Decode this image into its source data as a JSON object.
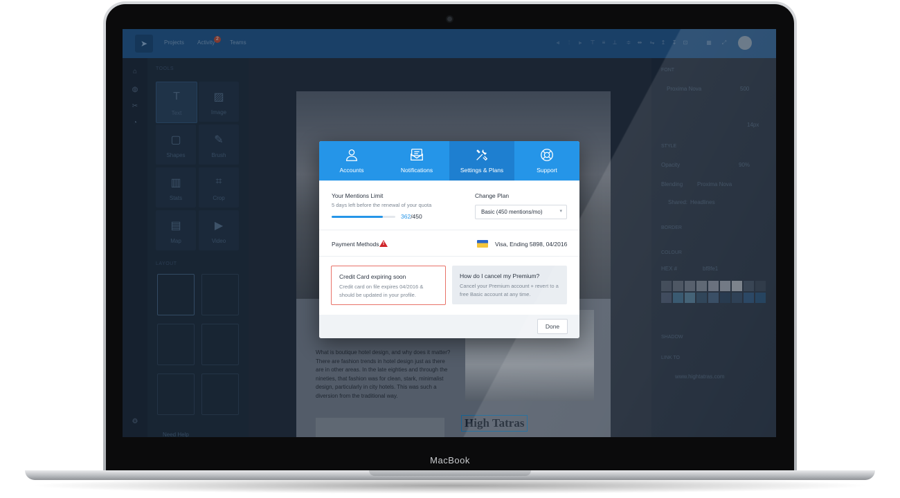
{
  "device": {
    "label": "MacBook"
  },
  "app": {
    "nav": {
      "projects": "Projects",
      "activity": "Activity",
      "activity_badge": "2",
      "teams": "Teams"
    },
    "tools_section": "TOOLS",
    "tools": [
      {
        "label": "Text",
        "icon": "text-icon"
      },
      {
        "label": "Image",
        "icon": "image-icon"
      },
      {
        "label": "Shapes",
        "icon": "shapes-icon"
      },
      {
        "label": "Brush",
        "icon": "brush-icon"
      },
      {
        "label": "Stats",
        "icon": "stats-icon"
      },
      {
        "label": "Crop",
        "icon": "crop-icon"
      },
      {
        "label": "Map",
        "icon": "map-icon"
      },
      {
        "label": "Video",
        "icon": "video-icon"
      }
    ],
    "layout_section": "LAYOUT",
    "need_help": "Need Help",
    "article": {
      "body": "What is boutique hotel design, and why does it matter? There are fashion trends in hotel design just as there are in other areas. In the late eighties and through the nineties, that fashion was for clean, stark, minimalist design, particularly in city hotels. This was such a diversion from the traditional way.",
      "heading": "High Tatras"
    },
    "right_panel": {
      "font_section": "FONT",
      "font_family": "Proxima Nova",
      "font_weight": "500",
      "font_size": "14px",
      "style_section": "STYLE",
      "opacity_label": "Opacity",
      "opacity_value": "90%",
      "blending_label": "Blending",
      "blending_value": "Proxima Nova",
      "shared_label": "Shared:",
      "shared_value": "Headlines",
      "border_section": "BORDER",
      "colour_section": "COLOUR",
      "hex_label": "HEX #",
      "hex_value": "bf8fe1",
      "shadow_section": "SHADOW",
      "link_section": "LINK TO",
      "link_value": "www.hightatras.com"
    }
  },
  "modal": {
    "tabs": [
      {
        "label": "Accounts",
        "icon": "user-icon"
      },
      {
        "label": "Notifications",
        "icon": "envelope-icon"
      },
      {
        "label": "Settings & Plans",
        "icon": "tools-icon",
        "active": true
      },
      {
        "label": "Support",
        "icon": "lifebuoy-icon"
      }
    ],
    "mentions": {
      "title": "Your Mentions Limit",
      "subtitle": "5 days left before the renewal of your quota",
      "used": "362",
      "total": "/450",
      "fraction": 0.804
    },
    "plan": {
      "title": "Change Plan",
      "selected": "Basic (450 mentions/mo)"
    },
    "payment": {
      "title": "Payment Methods",
      "card": "Visa, Ending 5898, 04/2016"
    },
    "alert_card": {
      "title": "Credit Card expiring soon",
      "body": "Credit card on file expires 04/2016 & should be updated in your profile."
    },
    "info_card": {
      "title": "How do I cancel my Premium?",
      "body": "Cancel your Premium account + revert to a free Basic account at any time."
    },
    "done_label": "Done"
  },
  "colors": {
    "accent": "#2595e8",
    "active_tab": "#1e7fd0",
    "alert_border": "#e87167",
    "warning": "#d0252a"
  }
}
